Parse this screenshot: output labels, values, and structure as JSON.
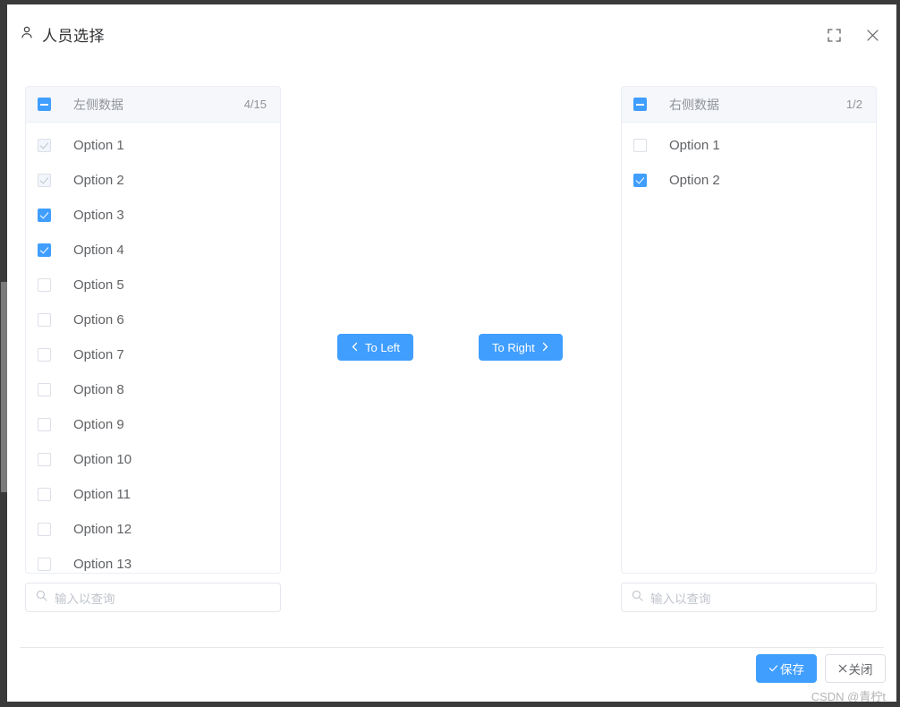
{
  "window": {
    "title": "人员选择",
    "title_icon": "person-icon",
    "fullscreen_icon": "fullscreen-expand-icon",
    "close_icon": "close-icon"
  },
  "transfer": {
    "left_panel": {
      "header_label": "左侧数据",
      "count": "4/15",
      "header_checkbox_state": "indeterminate",
      "items": [
        {
          "label": "Option 1",
          "state": "disabled-checked"
        },
        {
          "label": "Option 2",
          "state": "disabled-checked"
        },
        {
          "label": "Option 3",
          "state": "checked"
        },
        {
          "label": "Option 4",
          "state": "checked"
        },
        {
          "label": "Option 5",
          "state": "unchecked"
        },
        {
          "label": "Option 6",
          "state": "unchecked"
        },
        {
          "label": "Option 7",
          "state": "unchecked"
        },
        {
          "label": "Option 8",
          "state": "unchecked"
        },
        {
          "label": "Option 9",
          "state": "unchecked"
        },
        {
          "label": "Option 10",
          "state": "unchecked"
        },
        {
          "label": "Option 11",
          "state": "unchecked"
        },
        {
          "label": "Option 12",
          "state": "unchecked"
        },
        {
          "label": "Option 13",
          "state": "unchecked"
        }
      ],
      "search_placeholder": "输入以查询",
      "search_value": "",
      "search_icon": "search-icon"
    },
    "right_panel": {
      "header_label": "右侧数据",
      "count": "1/2",
      "header_checkbox_state": "indeterminate",
      "items": [
        {
          "label": "Option 1",
          "state": "unchecked"
        },
        {
          "label": "Option 2",
          "state": "checked"
        }
      ],
      "search_placeholder": "输入以查询",
      "search_value": "",
      "search_icon": "search-icon"
    },
    "to_left_label": "To Left",
    "to_right_label": "To Right",
    "to_left_icon": "chevron-left-icon",
    "to_right_icon": "chevron-right-icon"
  },
  "footer": {
    "save_label": "保存",
    "save_icon": "check-icon",
    "cancel_label": "关闭",
    "cancel_icon": "close-icon"
  },
  "watermark": "CSDN @青柠t",
  "colors": {
    "accent": "#409eff",
    "header_bg": "#f5f7fa",
    "border": "#ebeef5",
    "text": "#606266",
    "muted": "#909399",
    "chrome": "#3a3a3a"
  }
}
